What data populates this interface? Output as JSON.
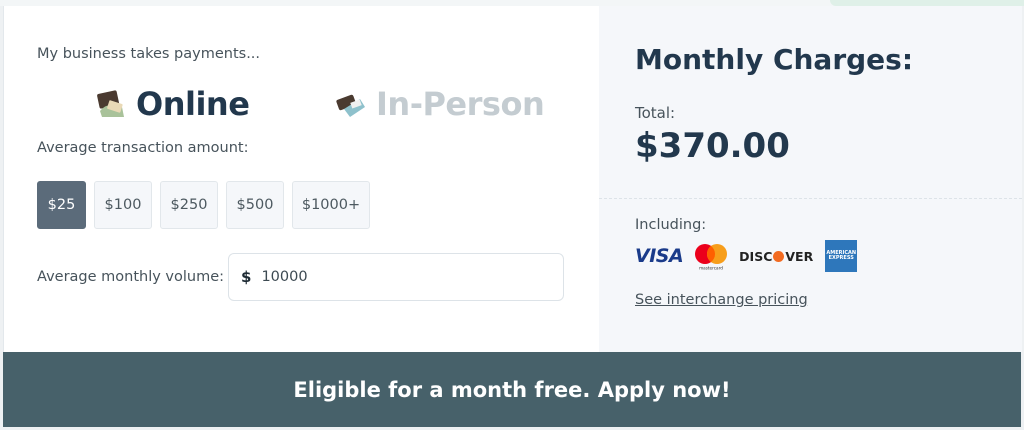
{
  "intro": "My business takes payments...",
  "modes": {
    "online": {
      "label": "Online",
      "icon": "online-payment-icon"
    },
    "in_person": {
      "label": "In-Person",
      "icon": "card-swipe-icon"
    }
  },
  "avg_transaction": {
    "label": "Average transaction amount:",
    "options": [
      "$25",
      "$100",
      "$250",
      "$500",
      "$1000+"
    ],
    "selected": "$25"
  },
  "monthly_volume": {
    "label": "Average monthly volume:",
    "currency": "$",
    "value": "10000"
  },
  "charges": {
    "title": "Monthly Charges:",
    "total_label": "Total:",
    "total_value": "$370.00",
    "including_label": "Including:",
    "card_brands": {
      "visa": "VISA",
      "mastercard_text": "mastercard",
      "discover_pre": "DISC",
      "discover_post": "VER",
      "amex": "AMERICAN EXPRESS"
    },
    "interchange_link": "See interchange pricing"
  },
  "cta": "Eligible for a month free.  Apply now!",
  "colors": {
    "primary_dark": "#22384d",
    "cta_bg": "#47616a",
    "active_button": "#5b6b7a",
    "inactive_mode": "#c4ccd1"
  }
}
